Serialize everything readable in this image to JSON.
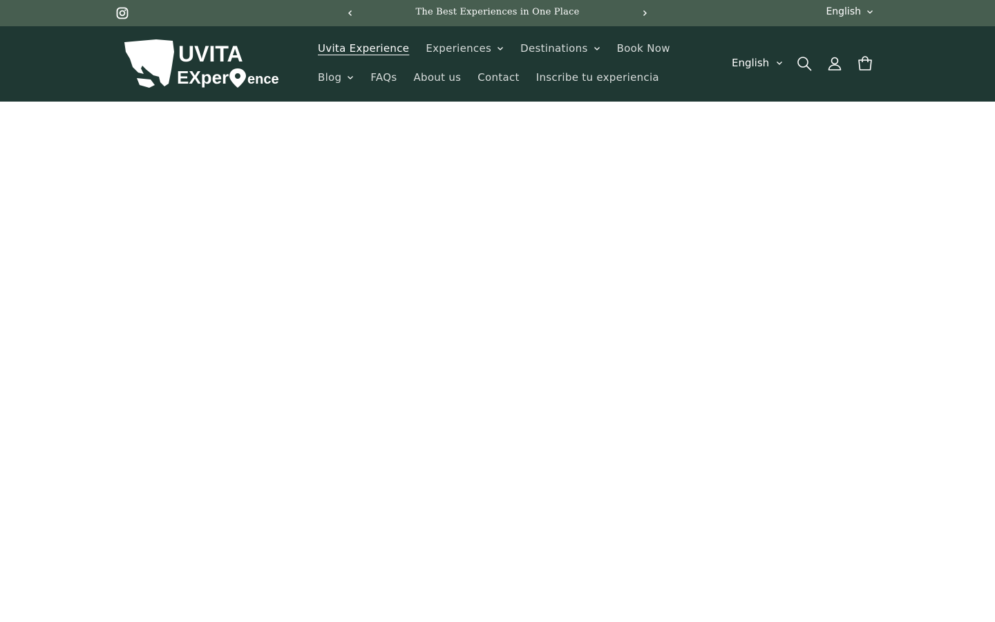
{
  "announcement": {
    "text": "The Best Experiences in One Place",
    "language": "English",
    "social_icon": "instagram-icon"
  },
  "header": {
    "logo_text_top": "UVITA",
    "logo_text_bottom_left": "EXper",
    "logo_text_bottom_right": "ence",
    "nav_row1": [
      {
        "label": "Uvita Experience",
        "dropdown": false
      },
      {
        "label": "Experiences",
        "dropdown": true
      },
      {
        "label": "Destinations",
        "dropdown": true
      },
      {
        "label": "Book Now",
        "dropdown": false
      }
    ],
    "nav_row2": [
      {
        "label": "Blog",
        "dropdown": true
      },
      {
        "label": "FAQs",
        "dropdown": false
      },
      {
        "label": "About us",
        "dropdown": false
      },
      {
        "label": "Contact",
        "dropdown": false
      },
      {
        "label": "Inscribe tu experiencia",
        "dropdown": false
      }
    ],
    "language": "English",
    "icons": [
      "search-icon",
      "account-icon",
      "cart-icon"
    ]
  },
  "colors": {
    "announcement_bg": "#475e50",
    "header_bg": "#1f3833",
    "text": "#ffffff"
  }
}
